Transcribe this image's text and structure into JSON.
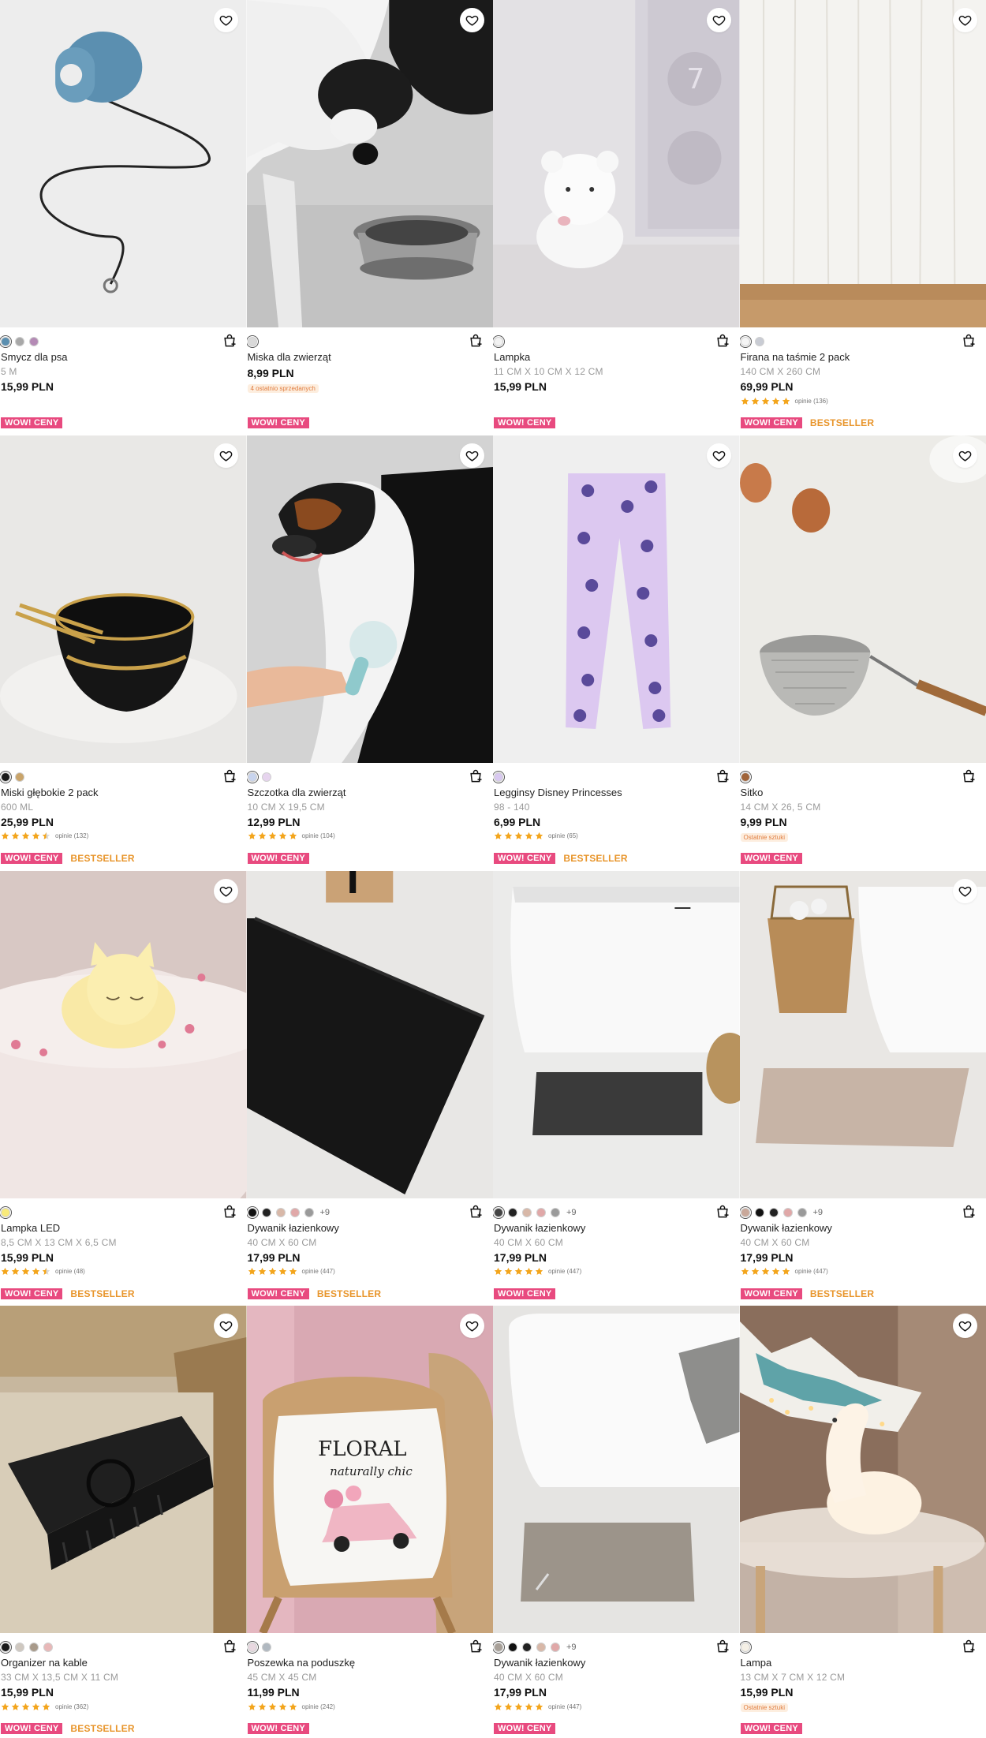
{
  "ui": {
    "colors": {
      "wow_badge": "#e84a7f",
      "bestseller": "#e8952b",
      "star": "#f3a51c",
      "note_bg": "#fdeedf",
      "note_text": "#e07b3d"
    },
    "icons": {
      "favorite": "heart-icon",
      "cart": "add-to-cart-icon",
      "star": "star-icon"
    }
  },
  "products": [
    {
      "name": "Smycz dla psa",
      "size": "5 M",
      "price": "15,99 PLN",
      "note": "",
      "rating": null,
      "reviews": "",
      "wow": "WOW! CENY",
      "bestseller": "",
      "swatches": [
        "#5b8fb0",
        "#a8a8a8",
        "#b48ab5"
      ],
      "more": ""
    },
    {
      "name": "Miska dla zwierząt",
      "size": "",
      "price": "8,99 PLN",
      "note": "4 ostatnio sprzedanych",
      "rating": null,
      "reviews": "",
      "wow": "WOW! CENY",
      "bestseller": "",
      "swatches": [
        "#d9d9d9"
      ],
      "more": ""
    },
    {
      "name": "Lampka",
      "size": "11 CM X 10 CM X 12 CM",
      "price": "15,99 PLN",
      "note": "",
      "rating": null,
      "reviews": "",
      "wow": "WOW! CENY",
      "bestseller": "",
      "swatches": [
        "#f2f2f2"
      ],
      "more": ""
    },
    {
      "name": "Firana na taśmie 2 pack",
      "size": "140 CM X 260 CM",
      "price": "69,99 PLN",
      "note": "",
      "rating": 5,
      "reviews": "opinie (136)",
      "wow": "WOW! CENY",
      "bestseller": "BESTSELLER",
      "swatches": [
        "#f5f5f5",
        "#c9ccd4"
      ],
      "more": ""
    },
    {
      "name": "Miski głębokie 2 pack",
      "size": "600 ML",
      "price": "25,99 PLN",
      "note": "",
      "rating": 4.5,
      "reviews": "opinie (132)",
      "wow": "WOW! CENY",
      "bestseller": "BESTSELLER",
      "swatches": [
        "#1a1a1a",
        "#c9a46a"
      ],
      "more": ""
    },
    {
      "name": "Szczotka dla zwierząt",
      "size": "10 CM X 19,5 CM",
      "price": "12,99 PLN",
      "note": "",
      "rating": 5,
      "reviews": "opinie (104)",
      "wow": "WOW! CENY",
      "bestseller": "",
      "swatches": [
        "#c8d4ee",
        "#e6d4ee"
      ],
      "more": ""
    },
    {
      "name": "Legginsy Disney Princesses",
      "size": "98 - 140",
      "price": "6,99 PLN",
      "note": "",
      "rating": 5,
      "reviews": "opinie (65)",
      "wow": "WOW! CENY",
      "bestseller": "BESTSELLER",
      "swatches": [
        "#d8c8f0"
      ],
      "more": ""
    },
    {
      "name": "Sitko",
      "size": "14 CM X 26, 5 CM",
      "price": "9,99 PLN",
      "note": "Ostatnie sztuki",
      "rating": null,
      "reviews": "",
      "wow": "WOW! CENY",
      "bestseller": "",
      "swatches": [
        "#a0643a"
      ],
      "more": ""
    },
    {
      "name": "Lampka LED",
      "size": "8,5 CM X 13 CM X 6,5 CM",
      "price": "15,99 PLN",
      "note": "",
      "rating": 4.5,
      "reviews": "opinie (48)",
      "wow": "WOW! CENY",
      "bestseller": "BESTSELLER",
      "swatches": [
        "#f8ea7a"
      ],
      "more": ""
    },
    {
      "name": "Dywanik łazienkowy",
      "size": "40 CM X 60 CM",
      "price": "17,99 PLN",
      "note": "",
      "rating": 5,
      "reviews": "opinie (447)",
      "wow": "WOW! CENY",
      "bestseller": "BESTSELLER",
      "swatches": [
        "#111111",
        "#222222",
        "#d8b8a8",
        "#e0a8a8",
        "#9a9a9a"
      ],
      "more": "+9"
    },
    {
      "name": "Dywanik łazienkowy",
      "size": "40 CM X 60 CM",
      "price": "17,99 PLN",
      "note": "",
      "rating": 5,
      "reviews": "opinie (447)",
      "wow": "WOW! CENY",
      "bestseller": "",
      "swatches": [
        "#444444",
        "#222222",
        "#d8b8a8",
        "#e0a8a8",
        "#9a9a9a"
      ],
      "more": "+9"
    },
    {
      "name": "Dywanik łazienkowy",
      "size": "40 CM X 60 CM",
      "price": "17,99 PLN",
      "note": "",
      "rating": 5,
      "reviews": "opinie (447)",
      "wow": "WOW! CENY",
      "bestseller": "BESTSELLER",
      "swatches": [
        "#c9a89a",
        "#111111",
        "#222222",
        "#e0a8a8",
        "#9a9a9a"
      ],
      "more": "+9"
    },
    {
      "name": "Organizer na kable",
      "size": "33 CM X 13,5 CM X 11 CM",
      "price": "15,99 PLN",
      "note": "",
      "rating": 5,
      "reviews": "opinie (362)",
      "wow": "WOW! CENY",
      "bestseller": "BESTSELLER",
      "swatches": [
        "#1a1a1a",
        "#cfc8c0",
        "#a89a8a",
        "#e8b8b8"
      ],
      "more": ""
    },
    {
      "name": "Poszewka na poduszkę",
      "size": "45 CM X 45 CM",
      "price": "11,99 PLN",
      "note": "",
      "rating": 5,
      "reviews": "opinie (242)",
      "wow": "WOW! CENY",
      "bestseller": "",
      "swatches": [
        "#e8d8e0",
        "#b0b8c0"
      ],
      "more": ""
    },
    {
      "name": "Dywanik łazienkowy",
      "size": "40 CM X 60 CM",
      "price": "17,99 PLN",
      "note": "",
      "rating": 5,
      "reviews": "opinie (447)",
      "wow": "WOW! CENY",
      "bestseller": "",
      "swatches": [
        "#a8a098",
        "#111111",
        "#222222",
        "#d8b8a8",
        "#e0a8a8"
      ],
      "more": "+9"
    },
    {
      "name": "Lampa",
      "size": "13 CM X 7 CM X 12 CM",
      "price": "15,99 PLN",
      "note": "Ostatnie sztuki",
      "rating": null,
      "reviews": "",
      "wow": "WOW! CENY",
      "bestseller": "",
      "swatches": [
        "#f5f0e6"
      ],
      "more": ""
    }
  ]
}
